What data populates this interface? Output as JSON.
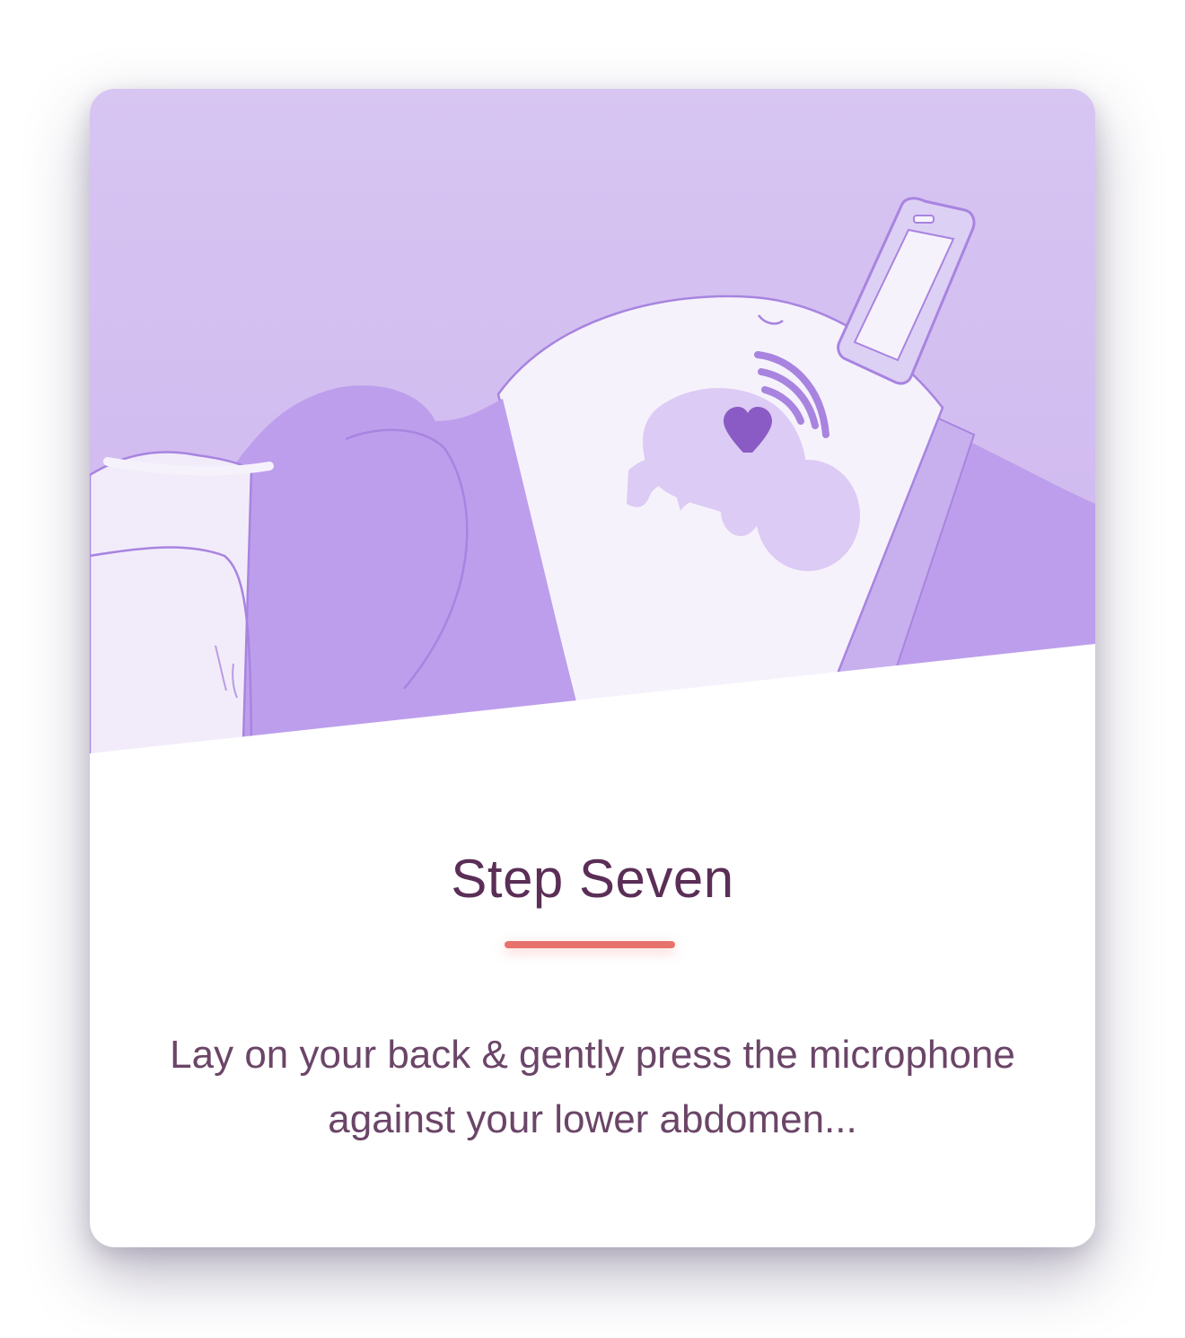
{
  "card": {
    "title": "Step Seven",
    "description": "Lay on your back & gently press the microphone against your lower abdomen..."
  },
  "theme": {
    "title_color": "#5a2e57",
    "text_color": "#6b4568",
    "accent_color": "#e7716b",
    "illustration_bg": "#d6c3f1",
    "garment_color": "#bd9eec",
    "belly_color": "#f6f2fc",
    "baby_color": "#dccbf4",
    "heart_color": "#8a5bc4"
  },
  "illustration": {
    "icons": [
      "phone-icon",
      "heart-icon",
      "sound-waves-icon",
      "baby-silhouette"
    ]
  }
}
